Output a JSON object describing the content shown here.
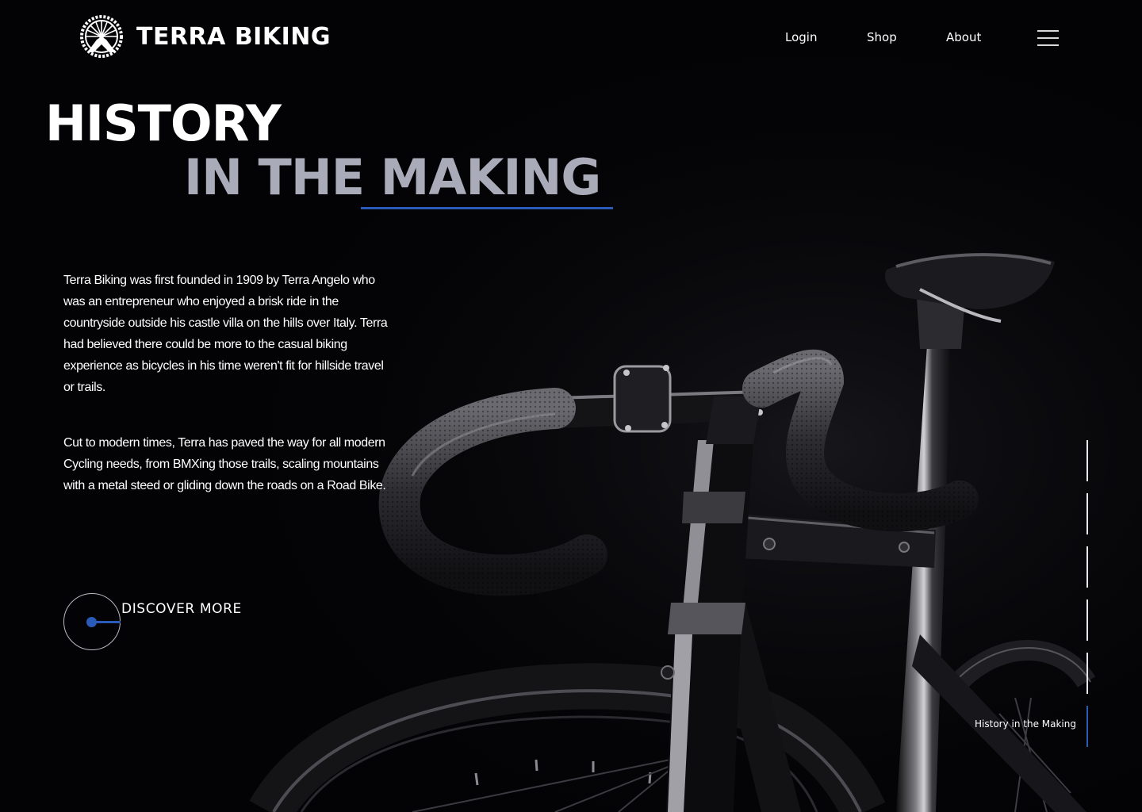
{
  "header": {
    "brand": "TERRA BIKING",
    "nav": [
      "Login",
      "Shop",
      "About"
    ]
  },
  "hero": {
    "title_line1": "HISTORY",
    "title_line2": "IN THE MAKING",
    "paragraphs": [
      "Terra Biking was first founded in 1909 by Terra Angelo who was an entrepreneur who enjoyed a brisk ride in the countryside outside his castle villa on the hills over Italy. Terra had believed there could be more to the casual biking experience as bicycles in his time weren't fit for hillside travel or trails.",
      "Cut to modern times, Terra has paved the way for all modern Cycling needs, from BMXing those trails, scaling mountains with a metal steed or gliding down the roads on a Road Bike."
    ],
    "cta": "DISCOVER MORE"
  },
  "section_indicator": {
    "active_label": "History in the Making",
    "total_sections": 6,
    "active_index": 5
  },
  "colors": {
    "background": "#030305",
    "accent": "#2a5bb8",
    "headline_muted": "#a9abb8",
    "text": "#ffffff"
  },
  "icons": [
    "bike-wheel-logo-icon",
    "hamburger-menu-icon"
  ]
}
